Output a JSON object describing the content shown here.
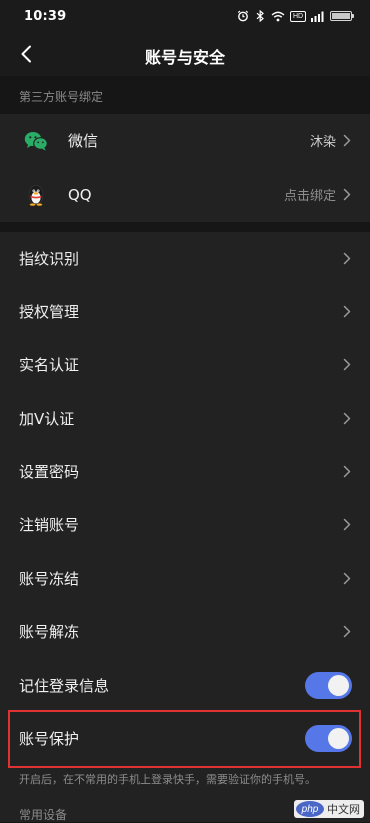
{
  "status_bar": {
    "time": "10:39",
    "icons": [
      "alarm-icon",
      "bluetooth-icon",
      "wifi-icon",
      "hd-icon",
      "signal-icon",
      "battery-icon"
    ],
    "hd_label": "HD"
  },
  "header": {
    "title": "账号与安全",
    "back_icon": "back-arrow-icon"
  },
  "third_party": {
    "section_title": "第三方账号绑定",
    "items": [
      {
        "label": "微信",
        "value": "沐染",
        "icon": "wechat-icon",
        "icon_color": "#2aae67"
      },
      {
        "label": "QQ",
        "value": "点击绑定",
        "icon": "qq-penguin-icon"
      }
    ]
  },
  "settings": {
    "items": [
      {
        "label": "指纹识别"
      },
      {
        "label": "授权管理"
      },
      {
        "label": "实名认证"
      },
      {
        "label": "加V认证"
      },
      {
        "label": "设置密码"
      },
      {
        "label": "注销账号"
      },
      {
        "label": "账号冻结"
      },
      {
        "label": "账号解冻"
      }
    ],
    "toggles": [
      {
        "label": "记住登录信息",
        "on": true
      },
      {
        "label": "账号保护",
        "on": true
      }
    ],
    "protection_hint": "开启后，在不常用的手机上登录快手，需要验证你的手机号。",
    "next_section_partial": "常用设备"
  },
  "colors": {
    "toggle_on": "#5577e8",
    "highlight": "#e03232",
    "background": "#161616",
    "card": "#222222"
  },
  "watermark": {
    "oval_text": "php",
    "text": "中文网"
  }
}
